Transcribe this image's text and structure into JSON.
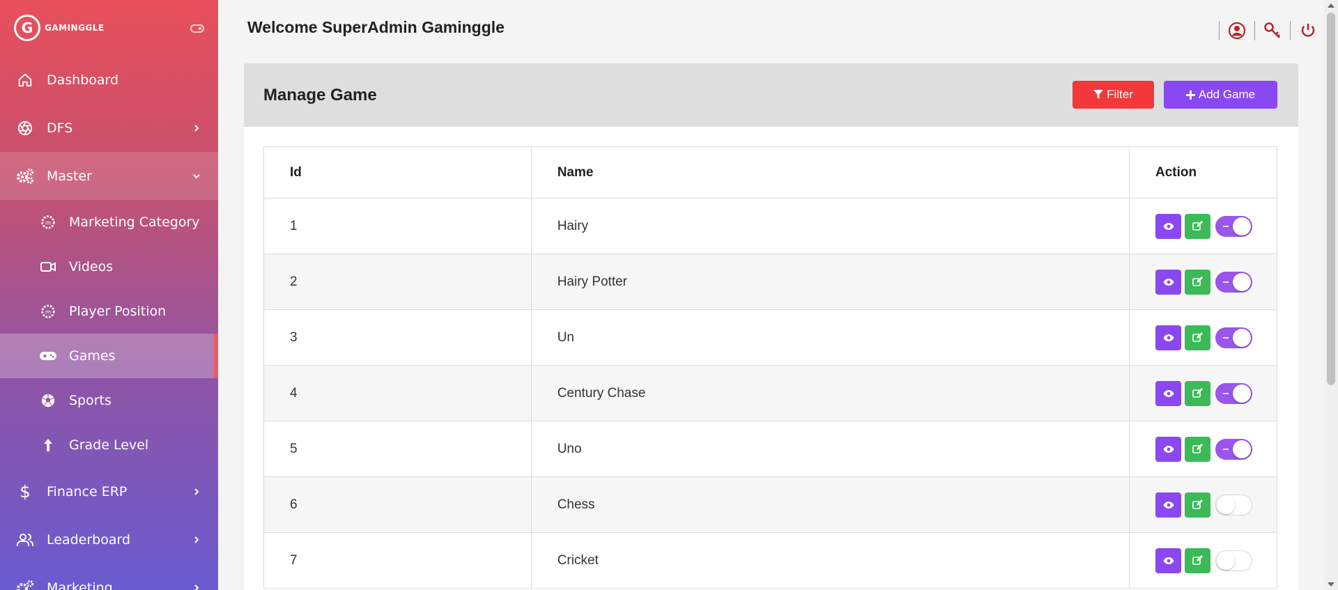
{
  "brand": {
    "mark": "G",
    "name": "GAMINGGLE"
  },
  "sidebar": {
    "items": [
      {
        "label": "Dashboard",
        "icon": "home-icon"
      },
      {
        "label": "DFS",
        "icon": "aperture-icon"
      },
      {
        "label": "Master",
        "icon": "gears-icon"
      },
      {
        "label": "Finance ERP",
        "icon": "dollar-icon"
      },
      {
        "label": "Leaderboard",
        "icon": "users-icon"
      },
      {
        "label": "Marketing",
        "icon": "gears-icon"
      }
    ],
    "master_sub": [
      {
        "label": "Marketing Category",
        "icon": "badge-icon"
      },
      {
        "label": "Videos",
        "icon": "video-icon"
      },
      {
        "label": "Player Position",
        "icon": "badge-icon"
      },
      {
        "label": "Games",
        "icon": "gamepad-icon"
      },
      {
        "label": "Sports",
        "icon": "soccer-ball-icon"
      },
      {
        "label": "Grade Level",
        "icon": "arrow-up-icon"
      }
    ]
  },
  "header": {
    "welcome": "Welcome SuperAdmin Gaminggle"
  },
  "page": {
    "title": "Manage Game",
    "filter_label": "Filter",
    "add_label": "Add Game"
  },
  "table": {
    "columns": [
      "Id",
      "Name",
      "Action"
    ],
    "rows": [
      {
        "id": "1",
        "name": "Hairy",
        "active": true
      },
      {
        "id": "2",
        "name": "Hairy Potter",
        "active": true
      },
      {
        "id": "3",
        "name": "Un",
        "active": true
      },
      {
        "id": "4",
        "name": "Century Chase",
        "active": true
      },
      {
        "id": "5",
        "name": "Uno",
        "active": true
      },
      {
        "id": "6",
        "name": "Chess",
        "active": false
      },
      {
        "id": "7",
        "name": "Cricket",
        "active": false
      }
    ]
  },
  "colors": {
    "accent": "#8a48f2",
    "danger": "#f2383a",
    "success": "#3bba57",
    "icon_red": "#b3262b"
  }
}
